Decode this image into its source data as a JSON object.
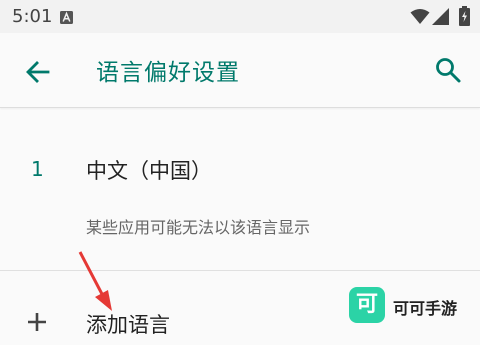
{
  "status_bar": {
    "time": "5:01",
    "notification_icon": "a-icon",
    "icons": [
      "wifi-icon",
      "signal-icon",
      "battery-icon"
    ]
  },
  "app_bar": {
    "back_icon": "arrow-left-icon",
    "title": "语言偏好设置",
    "search_icon": "search-icon",
    "accent_color": "#00796b"
  },
  "languages": [
    {
      "index": "1",
      "name": "中文（中国）",
      "note": "某些应用可能无法以该语言显示"
    }
  ],
  "add_language": {
    "icon": "plus-icon",
    "label": "添加语言"
  },
  "watermark": {
    "logo_char": "可",
    "text": "可可手游",
    "color": "#2bd3a6"
  },
  "annotation": {
    "arrow_color": "#e53935"
  }
}
